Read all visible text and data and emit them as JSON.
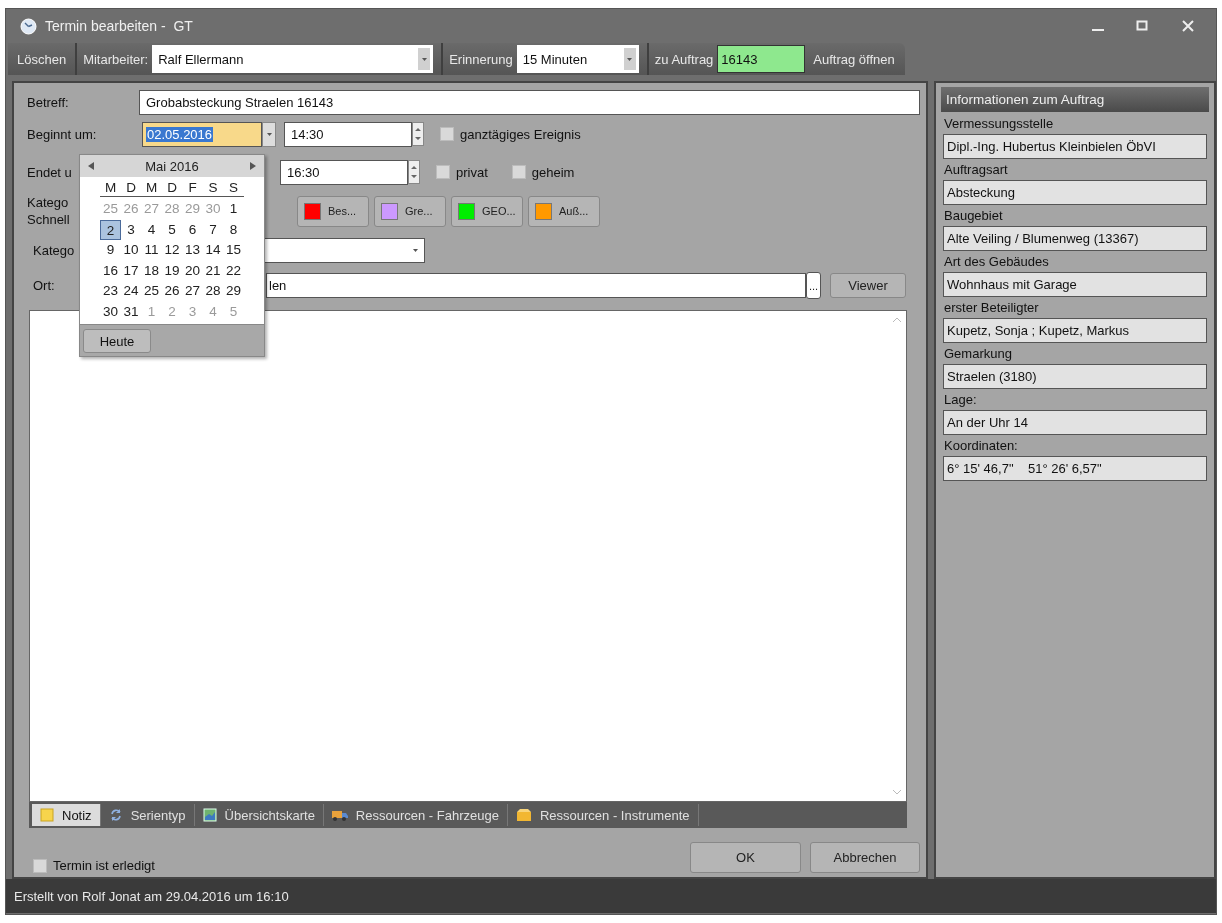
{
  "window": {
    "title": "Termin bearbeiten -  GT"
  },
  "toolbar": {
    "delete_button": "Löschen",
    "employee_label": "Mitarbeiter:",
    "employee": "Ralf Ellermann",
    "reminder_label": "Erinnerung",
    "reminder": "15 Minuten",
    "order_label": "zu Auftrag",
    "order_number": "16143",
    "open_order_button": "Auftrag öffnen"
  },
  "form": {
    "subject_label": "Betreff:",
    "subject": "Grobabsteckung Straelen 16143",
    "start_label": "Beginnt um:",
    "start_date": "02.05.2016",
    "start_time": "14:30",
    "end_label": "Endet u",
    "end_time": "16:30",
    "options": [
      {
        "label": "ganztägiges Ereignis",
        "checked": false
      },
      {
        "label": "privat",
        "checked": false
      },
      {
        "label": "geheim",
        "checked": false
      }
    ],
    "category_label": "Katego",
    "quick_label": "Schnell",
    "quick_categories": [
      {
        "label": "Bes...",
        "color": "#ff0000"
      },
      {
        "label": "Gre...",
        "color": "#cc99ff"
      },
      {
        "label": "GEO...",
        "color": "#00ee00"
      },
      {
        "label": "Auß...",
        "color": "#ff9900"
      }
    ],
    "category_field_label": "Katego",
    "location_label": "Ort:",
    "location": "len",
    "location_button": "...",
    "viewer_button": "Viewer"
  },
  "tabs": [
    {
      "label": "Notiz",
      "selected": true
    },
    {
      "label": "Serientyp",
      "selected": false
    },
    {
      "label": "Übersichtskarte",
      "selected": false
    },
    {
      "label": "Ressourcen - Fahrzeuge",
      "selected": false
    },
    {
      "label": "Ressourcen - Instrumente",
      "selected": false
    }
  ],
  "done": {
    "label": "Termin ist erledigt",
    "checked": false
  },
  "buttons": [
    "OK",
    "Abbrechen"
  ],
  "info_panel": {
    "title": "Informationen zum Auftrag",
    "fields": [
      {
        "label": "Vermessungsstelle",
        "value": "Dipl.-Ing. Hubertus Kleinbielen ÖbVI"
      },
      {
        "label": "Auftragsart",
        "value": "Absteckung"
      },
      {
        "label": "Baugebiet",
        "value": "Alte Veiling / Blumenweg (13367)"
      },
      {
        "label": "Art des Gebäudes",
        "value": "Wohnhaus mit Garage"
      },
      {
        "label": "erster Beteiligter",
        "value": "Kupetz, Sonja ; Kupetz, Markus"
      },
      {
        "label": "Gemarkung",
        "value": "Straelen (3180)"
      },
      {
        "label": "Lage:",
        "value": "An der Uhr 14"
      },
      {
        "label": "Koordinaten:",
        "value": "6° 15' 46,7\"    51° 26' 6,57\""
      }
    ]
  },
  "calendar": {
    "month": "Mai 2016",
    "weekdays": [
      "M",
      "D",
      "M",
      "D",
      "F",
      "S",
      "S"
    ],
    "today_button": "Heute",
    "weeks": [
      [
        {
          "day": "25",
          "other_month": true,
          "selected": false
        },
        {
          "day": "26",
          "other_month": true,
          "selected": false
        },
        {
          "day": "27",
          "other_month": true,
          "selected": false
        },
        {
          "day": "28",
          "other_month": true,
          "selected": false
        },
        {
          "day": "29",
          "other_month": true,
          "selected": false
        },
        {
          "day": "30",
          "other_month": true,
          "selected": false
        },
        {
          "day": "1",
          "other_month": false,
          "selected": false
        }
      ],
      [
        {
          "day": "2",
          "other_month": false,
          "selected": true
        },
        {
          "day": "3",
          "other_month": false,
          "selected": false
        },
        {
          "day": "4",
          "other_month": false,
          "selected": false
        },
        {
          "day": "5",
          "other_month": false,
          "selected": false
        },
        {
          "day": "6",
          "other_month": false,
          "selected": false
        },
        {
          "day": "7",
          "other_month": false,
          "selected": false
        },
        {
          "day": "8",
          "other_month": false,
          "selected": false
        }
      ],
      [
        {
          "day": "9",
          "other_month": false,
          "selected": false
        },
        {
          "day": "10",
          "other_month": false,
          "selected": false
        },
        {
          "day": "11",
          "other_month": false,
          "selected": false
        },
        {
          "day": "12",
          "other_month": false,
          "selected": false
        },
        {
          "day": "13",
          "other_month": false,
          "selected": false
        },
        {
          "day": "14",
          "other_month": false,
          "selected": false
        },
        {
          "day": "15",
          "other_month": false,
          "selected": false
        }
      ],
      [
        {
          "day": "16",
          "other_month": false,
          "selected": false
        },
        {
          "day": "17",
          "other_month": false,
          "selected": false
        },
        {
          "day": "18",
          "other_month": false,
          "selected": false
        },
        {
          "day": "19",
          "other_month": false,
          "selected": false
        },
        {
          "day": "20",
          "other_month": false,
          "selected": false
        },
        {
          "day": "21",
          "other_month": false,
          "selected": false
        },
        {
          "day": "22",
          "other_month": false,
          "selected": false
        }
      ],
      [
        {
          "day": "23",
          "other_month": false,
          "selected": false
        },
        {
          "day": "24",
          "other_month": false,
          "selected": false
        },
        {
          "day": "25",
          "other_month": false,
          "selected": false
        },
        {
          "day": "26",
          "other_month": false,
          "selected": false
        },
        {
          "day": "27",
          "other_month": false,
          "selected": false
        },
        {
          "day": "28",
          "other_month": false,
          "selected": false
        },
        {
          "day": "29",
          "other_month": false,
          "selected": false
        }
      ],
      [
        {
          "day": "30",
          "other_month": false,
          "selected": false
        },
        {
          "day": "31",
          "other_month": false,
          "selected": false
        },
        {
          "day": "1",
          "other_month": true,
          "selected": false
        },
        {
          "day": "2",
          "other_month": true,
          "selected": false
        },
        {
          "day": "3",
          "other_month": true,
          "selected": false
        },
        {
          "day": "4",
          "other_month": true,
          "selected": false
        },
        {
          "day": "5",
          "other_month": true,
          "selected": false
        }
      ]
    ]
  },
  "status_bar": "Erstellt von Rolf Jonat am 29.04.2016 um 16:10"
}
